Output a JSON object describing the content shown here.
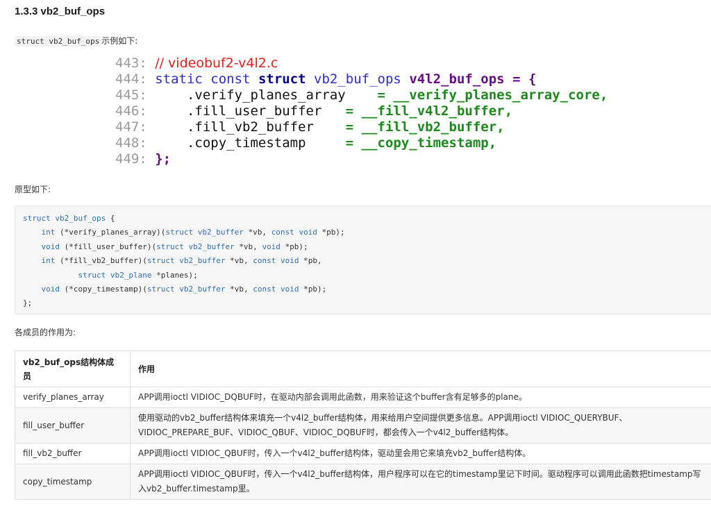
{
  "heading": "1.3.3 vb2_buf_ops",
  "intro": {
    "code": "struct vb2_buf_ops",
    "text": "示例如下:"
  },
  "snippet": {
    "lines": [
      {
        "num": "443:",
        "comment": "// videobuf2-v4l2.c"
      },
      {
        "num": "444:",
        "kw1": "static const",
        "kw2": "struct",
        "type": "vb2_buf_ops",
        "name": "v4l2_buf_ops",
        "eq": "= {"
      },
      {
        "num": "445:",
        "field": ".verify_planes_array",
        "eq": "=",
        "value": "__verify_planes_array_core",
        "tail": ","
      },
      {
        "num": "446:",
        "field": ".fill_user_buffer",
        "eq": "=",
        "value": "__fill_v4l2_buffer",
        "tail": ","
      },
      {
        "num": "447:",
        "field": ".fill_vb2_buffer",
        "eq": "=",
        "value": "__fill_vb2_buffer",
        "tail": ","
      },
      {
        "num": "448:",
        "field": ".copy_timestamp",
        "eq": "=",
        "value": "__copy_timestamp",
        "tail": ","
      },
      {
        "num": "449:",
        "close": "};"
      }
    ]
  },
  "proto_label": "原型如下:",
  "prototype": {
    "l1_kw": "struct",
    "l1_type": "vb2_buf_ops",
    "l1_rest": "{",
    "l2_a": "int",
    "l2_b": "(*verify_planes_array)(",
    "l2_c": "struct",
    "l2_d": "vb2_buffer",
    "l2_e": "*vb,",
    "l2_f": "const",
    "l2_g": "void",
    "l2_h": "*pb);",
    "l3_a": "void",
    "l3_b": "(*fill_user_buffer)(",
    "l3_c": "struct",
    "l3_d": "vb2_buffer",
    "l3_e": "*vb,",
    "l3_f": "void",
    "l3_g": "*pb);",
    "l4_a": "int",
    "l4_b": "(*fill_vb2_buffer)(",
    "l4_c": "struct",
    "l4_d": "vb2_buffer",
    "l4_e": "*vb,",
    "l4_f": "const",
    "l4_g": "void",
    "l4_h": "*pb,",
    "l5_a": "struct",
    "l5_b": "vb2_plane",
    "l5_c": "*planes);",
    "l6_a": "void",
    "l6_b": "(*copy_timestamp)(",
    "l6_c": "struct",
    "l6_d": "vb2_buffer",
    "l6_e": "*vb,",
    "l6_f": "const",
    "l6_g": "void",
    "l6_h": "*pb);",
    "l7": "};"
  },
  "members_label": "各成员的作用为:",
  "table": {
    "headers": [
      "vb2_buf_ops结构体成员",
      "作用"
    ],
    "rows": [
      [
        "verify_planes_array",
        "APP调用ioctl VIDIOC_DQBUF时，在驱动内部会调用此函数，用来验证这个buffer含有足够多的plane。"
      ],
      [
        "fill_user_buffer",
        "使用驱动的vb2_buffer结构体来填充一个v4l2_buffer结构体，用来给用户空间提供更多信息。APP调用ioctl VIDIOC_QUERYBUF、VIDIOC_PREPARE_BUF、VIDIOC_QBUF、VIDIOC_DQBUF时，都会传入一个v4l2_buffer结构体。"
      ],
      [
        "fill_vb2_buffer",
        "APP调用ioctl VIDIOC_QBUF时，传入一个v4l2_buffer结构体，驱动里会用它来填充vb2_buffer结构体。"
      ],
      [
        "copy_timestamp",
        "APP调用ioctl VIDIOC_QBUF时，传入一个v4l2_buffer结构体，用户程序可以在它的timestamp里记下时间。驱动程序可以调用此函数把timestamp写入vb2_buffer.timestamp里。"
      ]
    ]
  }
}
